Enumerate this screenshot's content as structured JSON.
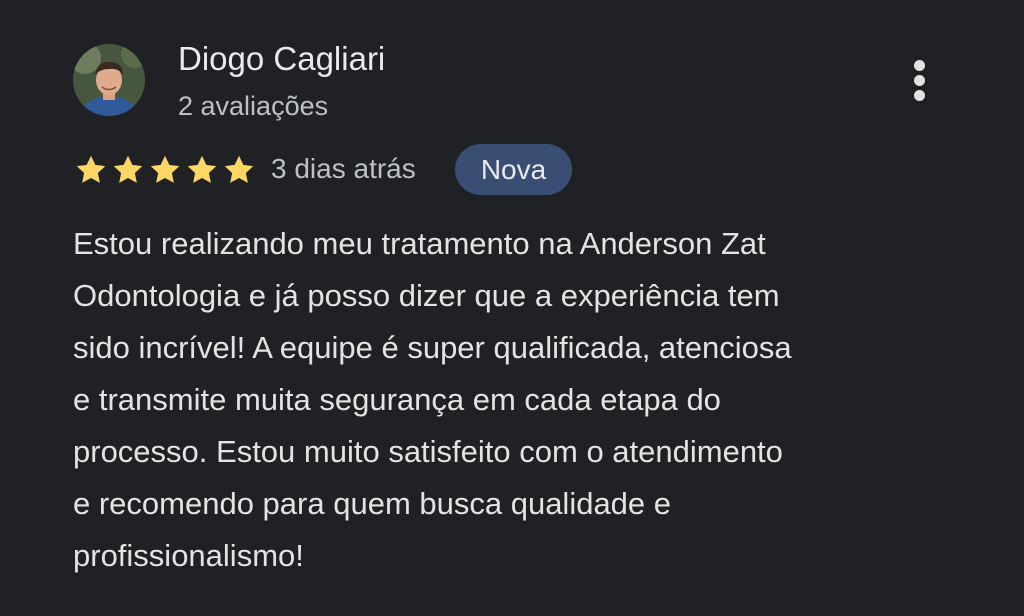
{
  "review": {
    "author_name": "Diogo Cagliari",
    "author_meta": "2 avaliações",
    "rating": 5,
    "max_rating": 5,
    "time_ago": "3 dias atrás",
    "badge": "Nova",
    "text_lines": [
      "Estou realizando meu tratamento na Anderson Zat",
      "Odontologia e já posso dizer que a experiência tem",
      "sido incrível! A equipe é super qualificada, atenciosa",
      "e transmite muita segurança em cada etapa do",
      "processo. Estou muito satisfeito com o atendimento",
      "e recomendo para quem busca qualidade e",
      "profissionalismo!"
    ]
  },
  "icons": {
    "star": "star-icon",
    "more": "more-vert-icon",
    "avatar": "avatar-photo"
  },
  "colors": {
    "background": "#202124",
    "star": "#fdd663",
    "badge_bg": "#394e72",
    "text": "#e3e3e3",
    "secondary_text": "#bdc1c6"
  }
}
